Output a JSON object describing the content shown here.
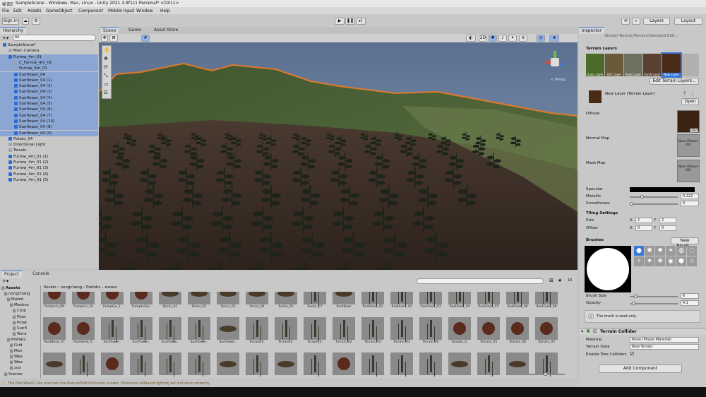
{
  "window": {
    "title": "SampleScene - Windows, Mac, Linux - Unity 2021.3.9f1c1 Personal* <DX11>",
    "app_short": "秘诀E"
  },
  "menu": [
    "File",
    "Edit",
    "Assets",
    "GameObject",
    "Component",
    "Mobile Input",
    "Window",
    "Help"
  ],
  "toolbar": {
    "account": "Sign in",
    "layers": "Layers",
    "layout": "Layout"
  },
  "hierarchy": {
    "tab": "Hierarchy",
    "search_placeholder": "All",
    "rows": [
      {
        "label": "SampleScene*",
        "indent": 0,
        "type": "scene",
        "sel": false
      },
      {
        "label": "Main Camera",
        "indent": 1,
        "type": "go",
        "sel": false
      },
      {
        "label": "Furrow_4m_01",
        "indent": 1,
        "type": "prefab",
        "sel": true
      },
      {
        "label": "C_Furrow_4m_01",
        "indent": 2,
        "type": "go",
        "sel": true
      },
      {
        "label": "Furrow_4m_01",
        "indent": 2,
        "type": "go",
        "sel": true
      },
      {
        "label": "Sunflower_04",
        "indent": 2,
        "type": "prefab",
        "sel": true
      },
      {
        "label": "Sunflower_04 (1)",
        "indent": 2,
        "type": "prefab",
        "sel": true
      },
      {
        "label": "Sunflower_04 (2)",
        "indent": 2,
        "type": "prefab",
        "sel": true
      },
      {
        "label": "Sunflower_04 (3)",
        "indent": 2,
        "type": "prefab",
        "sel": true
      },
      {
        "label": "Sunflower_04 (4)",
        "indent": 2,
        "type": "prefab",
        "sel": true
      },
      {
        "label": "Sunflower_04 (5)",
        "indent": 2,
        "type": "prefab",
        "sel": true
      },
      {
        "label": "Sunflower_04 (6)",
        "indent": 2,
        "type": "prefab",
        "sel": true
      },
      {
        "label": "Sunflower_04 (7)",
        "indent": 2,
        "type": "prefab",
        "sel": true
      },
      {
        "label": "Sunflower_04 (10)",
        "indent": 2,
        "type": "prefab",
        "sel": true
      },
      {
        "label": "Sunflower_04 (8)",
        "indent": 2,
        "type": "prefab",
        "sel": true
      },
      {
        "label": "Sunflower_04 (9)",
        "indent": 2,
        "type": "prefab",
        "sel": true
      },
      {
        "label": "Potato_04",
        "indent": 1,
        "type": "prefab",
        "sel": false
      },
      {
        "label": "Directional Light",
        "indent": 1,
        "type": "go",
        "sel": false
      },
      {
        "label": "Terrain",
        "indent": 1,
        "type": "go",
        "sel": false
      },
      {
        "label": "Furrow_4m_01 (1)",
        "indent": 1,
        "type": "prefab",
        "sel": false
      },
      {
        "label": "Furrow_4m_01 (2)",
        "indent": 1,
        "type": "prefab",
        "sel": false
      },
      {
        "label": "Furrow_4m_01 (3)",
        "indent": 1,
        "type": "prefab",
        "sel": false
      },
      {
        "label": "Furrow_4m_01 (4)",
        "indent": 1,
        "type": "prefab",
        "sel": false
      },
      {
        "label": "Furrow_4m_01 (5)",
        "indent": 1,
        "type": "prefab",
        "sel": false
      }
    ]
  },
  "scene": {
    "tabs": [
      "Scene",
      "Game",
      "Asset Store"
    ],
    "persp": "< Persp",
    "dim_2d": "2D",
    "gizmo_count": "10"
  },
  "project": {
    "tabs": [
      "Project",
      "Console"
    ],
    "breadcrumb": [
      "Assets",
      "nongchang",
      "Prefabs",
      "zuowu"
    ],
    "tree": [
      "Assets",
      "nongchang",
      "Materi",
      "Meshes",
      "Crop",
      "Flow",
      "Potat",
      "Sunfl",
      "Terra",
      "Prefabs",
      "Grid",
      "Man",
      "Wea",
      "Wea",
      "zuo",
      "Scenes"
    ],
    "slider_count": "16",
    "assets_row1": [
      "Pumpkin_09",
      "Pumpkin_10",
      "Pumpkin_1.",
      "PumpkinSe.",
      "Rocks_01",
      "Rocks_02",
      "Rocks_03",
      "Rocks_04",
      "Rocks_05",
      "Rocks_07",
      "RootBase",
      "RootFeed_01",
      "RootFeed_02",
      "RootFeed_03",
      "RootFeed_04",
      "RootFeed_05",
      "RootFeed_06",
      "RootFeed_08"
    ],
    "assets_row2": [
      "RootBase_07",
      "RootSeed_0.",
      "Sunflower..",
      "Sunflower..",
      "Sunflower..",
      "Sunflower..",
      "Sunflower..",
      "Terrain_0.",
      "Terrain_0.",
      "Terrain_0.",
      "Terrain_02",
      "Terrain_03",
      "Terrain_03",
      "Terrain_04",
      "Tomato_0.",
      "Tomato_05",
      "Tomato_06",
      "Tomato_07"
    ]
  },
  "status": {
    "message": "The Plot Was01.2da matches the Nature/Soft Occlusion shader. Otherwise billboard lighting will not work correctly."
  },
  "inspector": {
    "tab": "Inspector",
    "shader_line": "Shader  Nature/Terrain/Standard  Edit...",
    "terrain_layers_title": "Terrain Layers",
    "layer_names": [
      "Grass Layer",
      "Dirt Layer",
      "Rock Layer",
      "Earth Layer",
      "New Layer"
    ],
    "edit_layers_btn": "Edit Terrain Layers...",
    "layer_name": "New Layer (Terrain Layer)",
    "open_btn": "Open",
    "diffuse": "Diffuse",
    "normal_map": "Normal Map",
    "mask_map": "Mask Map",
    "none_texture": "None (Texture 2D)",
    "select": "Select",
    "specular": "Specular",
    "metallic": "Metallic",
    "metallic_val": "0.222",
    "smoothness": "Smoothness",
    "smoothness_val": "0",
    "tiling_title": "Tiling Settings",
    "size": "Size",
    "size_x": "2",
    "size_y": "2",
    "offset": "Offset",
    "offset_x": "0",
    "offset_y": "0",
    "x": "X",
    "y": "Y",
    "brushes": "Brushes",
    "new_brush": "New Brush...",
    "brush_size": "Brush Size",
    "brush_size_val": "6",
    "opacity": "Opacity",
    "opacity_val": "4.1",
    "read_only_note": "The brush is read-only.",
    "collider_title": "Terrain Collider",
    "material": "Material",
    "material_val": "None (Physic Material)",
    "terrain_data": "Terrain Data",
    "terrain_data_val": "New Terrain",
    "enable_tree": "Enable Tree Colliders",
    "add_component": "Add Component"
  }
}
